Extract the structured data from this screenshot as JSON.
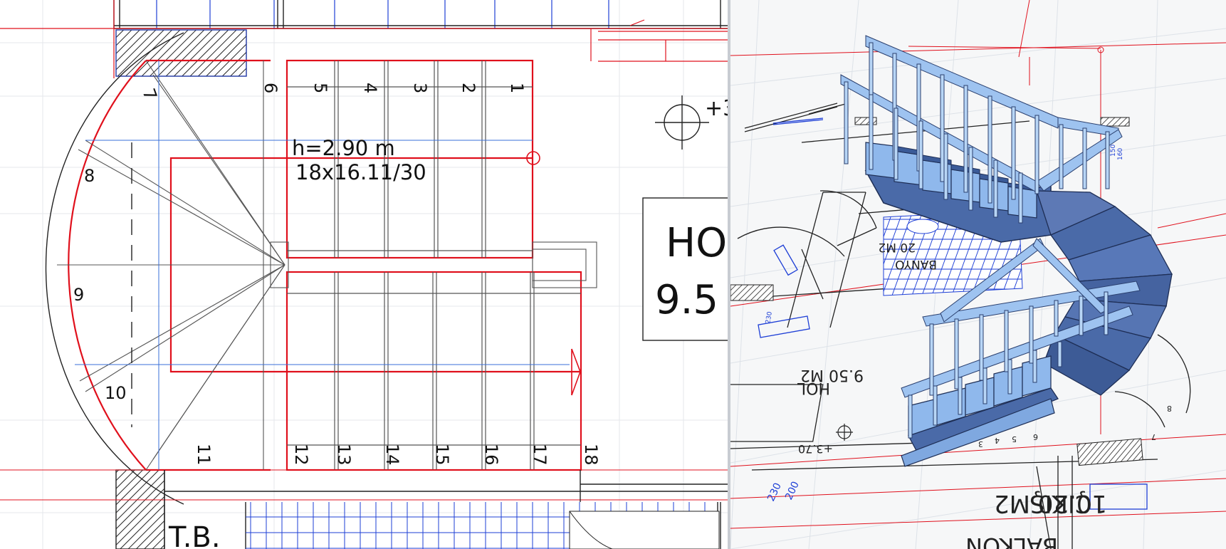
{
  "plan": {
    "stair_height_label": "h=2.90 m",
    "stair_riser_label": "18x16.11/30",
    "steps": [
      "1",
      "2",
      "3",
      "4",
      "5",
      "6",
      "7",
      "8",
      "9",
      "10",
      "11",
      "12",
      "13",
      "14",
      "15",
      "16",
      "17",
      "18"
    ],
    "room_name": "HO",
    "room_area": "9.5",
    "level_mark": "+3",
    "toilet_label": "T.B."
  },
  "perspective": {
    "room_labels": [
      "9.50 M2",
      "HOL",
      "+3.70",
      "20 M2",
      "BANYO",
      "10.20 M2",
      "BALKON",
      "ÇIKIŞ"
    ],
    "dims": [
      "230",
      "200",
      "150",
      "160",
      "230"
    ],
    "stair_step_labels": [
      "3",
      "4",
      "5",
      "6",
      "7",
      "8"
    ]
  },
  "colors": {
    "grid": "#e2e6ea",
    "red": "#e0101c",
    "blue": "#1e3fd6",
    "stair_light": "#8fb8ec",
    "stair_dark": "#4a6aa8"
  }
}
